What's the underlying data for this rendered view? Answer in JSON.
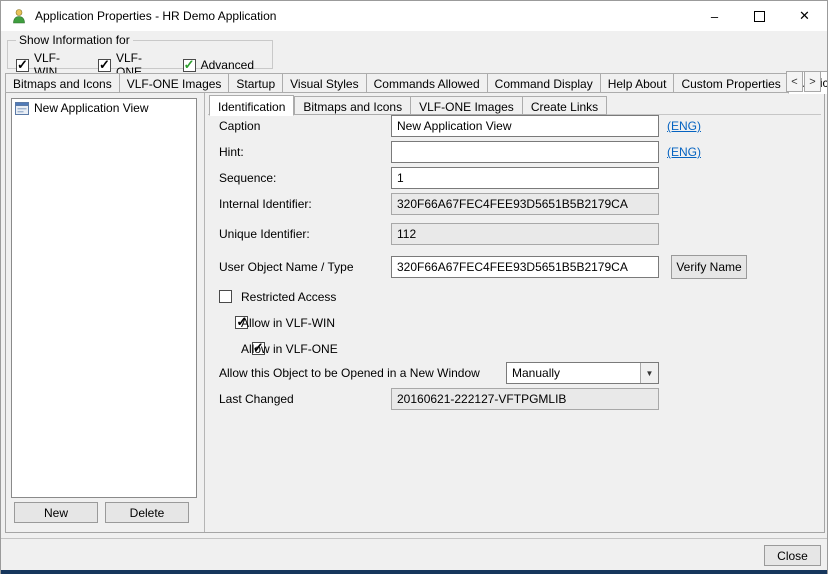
{
  "window": {
    "title": "Application Properties - HR Demo Application",
    "icons": {
      "minimize": "–",
      "close": "✕"
    }
  },
  "show_info": {
    "group_label": "Show Information for",
    "checkboxes": [
      {
        "label": "VLF-WIN",
        "checked": true
      },
      {
        "label": "VLF-ONE",
        "checked": true
      },
      {
        "label": "Advanced",
        "checked": true
      }
    ],
    "advanced_check_style": "color:#2e9e2e"
  },
  "outer_tabs": {
    "items": [
      "Bitmaps and Icons",
      "VLF-ONE Images",
      "Startup",
      "Visual Styles",
      "Commands Allowed",
      "Command Display",
      "Help About",
      "Custom Properties",
      "Application Views"
    ],
    "active": "Application Views",
    "scroll_left": "<",
    "scroll_right": ">"
  },
  "left_panel": {
    "items": [
      {
        "label": "New Application View",
        "selected": true
      }
    ],
    "new_button": "New",
    "delete_button": "Delete"
  },
  "inner_tabs": {
    "items": [
      "Identification",
      "Bitmaps and Icons",
      "VLF-ONE Images",
      "Create Links"
    ],
    "active": "Identification"
  },
  "form": {
    "caption": {
      "label": "Caption",
      "value": "New Application View",
      "lang": "(ENG)"
    },
    "hint": {
      "label": "Hint:",
      "value": "",
      "lang": "(ENG)"
    },
    "sequence": {
      "label": "Sequence:",
      "value": "1"
    },
    "internal_id": {
      "label": "Internal Identifier:",
      "value": "320F66A67FEC4FEE93D5651B5B2179CA"
    },
    "unique_id": {
      "label": "Unique Identifier:",
      "value": "112"
    },
    "user_object": {
      "label": "User Object Name / Type",
      "value": "320F66A67FEC4FEE93D5651B5B2179CA",
      "verify_button": "Verify Name"
    },
    "restricted": {
      "label": "Restricted Access",
      "checked": false
    },
    "allow_win": {
      "label": "Allow in VLF-WIN",
      "checked": true
    },
    "allow_one": {
      "label": "Allow in VLF-ONE",
      "checked": true
    },
    "open_new_window": {
      "label": "Allow this Object to be Opened in a New Window",
      "value": "Manually"
    },
    "last_changed": {
      "label": "Last Changed",
      "value": "20160621-222127-VFTPGMLIB"
    }
  },
  "footer": {
    "close_button": "Close"
  }
}
